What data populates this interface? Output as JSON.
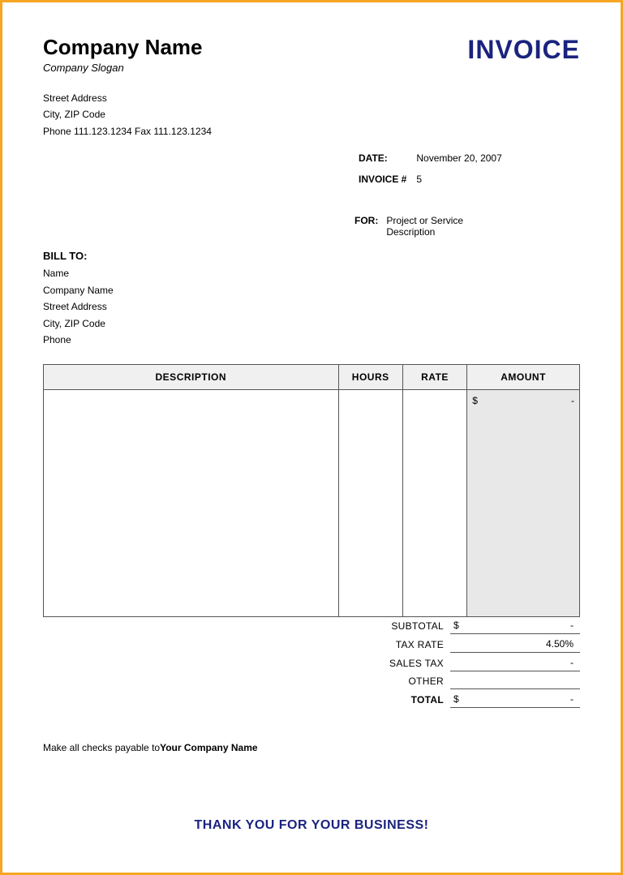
{
  "page": {
    "border_color": "#f5a623",
    "background": "white"
  },
  "header": {
    "company_name": "Company Name",
    "company_slogan": "Company Slogan",
    "invoice_title": "INVOICE"
  },
  "company_info": {
    "street": "Street Address",
    "city_zip": "City, ZIP Code",
    "phone_fax": "Phone 111.123.1234   Fax 111.123.1234"
  },
  "invoice_meta": {
    "date_label": "DATE:",
    "date_value": "November 20, 2007",
    "invoice_label": "INVOICE #",
    "invoice_value": "5",
    "for_label": "FOR:",
    "for_line1": "Project or Service",
    "for_line2": "Description"
  },
  "bill_to": {
    "label": "BILL TO:",
    "name": "Name",
    "company": "Company Name",
    "street": "Street Address",
    "city_zip": "City, ZIP Code",
    "phone": "Phone"
  },
  "table": {
    "headers": {
      "description": "DESCRIPTION",
      "hours": "HOURS",
      "rate": "RATE",
      "amount": "AMOUNT"
    },
    "amount_prefix": "$",
    "amount_dash": "-"
  },
  "totals": {
    "subtotal_label": "SUBTOTAL",
    "subtotal_dollar": "$",
    "subtotal_value": "-",
    "tax_rate_label": "TAX RATE",
    "tax_rate_value": "4.50%",
    "sales_tax_label": "SALES TAX",
    "sales_tax_value": "-",
    "other_label": "OTHER",
    "other_value": "",
    "total_label": "TOTAL",
    "total_dollar": "$",
    "total_value": "-"
  },
  "footer": {
    "checks_payable_text": "Make all checks payable to",
    "checks_payable_name": "Your Company Name",
    "thank_you": "THANK YOU FOR YOUR BUSINESS!"
  }
}
